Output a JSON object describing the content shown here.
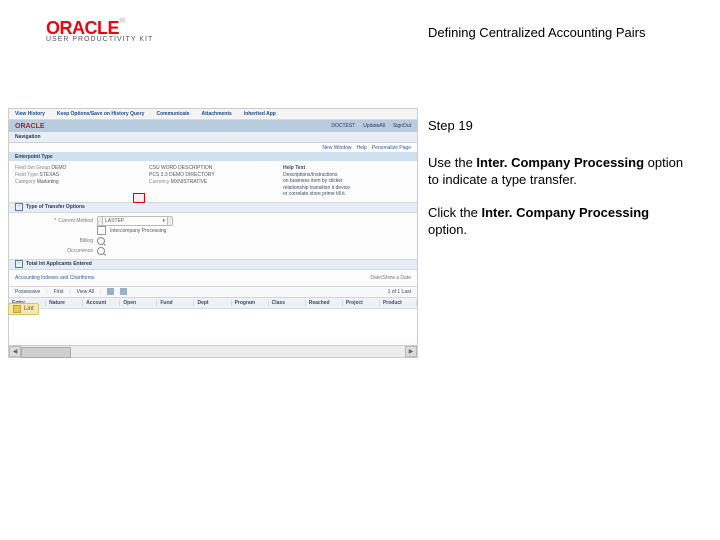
{
  "header": {
    "brand": "ORACLE",
    "tm": "®",
    "subbrand": "USER PRODUCTIVITY KIT",
    "title": "Defining Centralized Accounting Pairs"
  },
  "instructions": {
    "step": "Step 19",
    "use_pre": "Use the ",
    "use_bold": "Inter. Company Processing",
    "use_post": " option to indicate a type transfer.",
    "click_pre": "Click the ",
    "click_bold": "Inter. Company Processing",
    "click_post": " option."
  },
  "screenshot": {
    "topbar": [
      "View History",
      "Keep Options/Save on History Query",
      "Communicate",
      "Attachments",
      "Inherited App"
    ],
    "bluebar": {
      "brand": "ORACLE",
      "right": [
        "DOCTEST",
        "UpdateAll",
        "SignOut"
      ]
    },
    "subbar": [
      "Navigation"
    ],
    "crumb": {
      "left": "New Window",
      "mid": "Help",
      "right": "Personalize Page"
    },
    "band": "Enterpoint Type",
    "info_left": [
      [
        "Field Set Group",
        "DEMO"
      ],
      [
        "Field Type",
        "STEXAS"
      ],
      [
        "Category",
        "Marketing"
      ]
    ],
    "info_mid": [
      [
        "",
        "CSU WORD DESCRIPTION"
      ],
      [
        "",
        "PCS 3.3 DEMO DIRECTORY"
      ],
      [
        "Currency",
        "MXNISTRATIVE"
      ]
    ],
    "info_help": {
      "h": "Help Text",
      "lines": [
        "Descriptions/Instructions",
        "on business item by clicker",
        "relationship transition it device",
        "or correlate store prime till it."
      ]
    },
    "section1": "Type of Transfer Options",
    "form": {
      "currentMethod": {
        "label": "Current Method",
        "value": "LASTEP"
      },
      "interco": {
        "label": "Intercompany Processing"
      },
      "billing": {
        "label": "Billing",
        "value": ""
      },
      "occurrence": {
        "label": "Occurrence",
        "value": ""
      }
    },
    "section2": "Total Int Applicants Entered",
    "form2": {
      "acc": "Accounting Indexes and Chartforms",
      "date": "Date/Show a Date"
    },
    "toolbar": [
      "Possessive",
      "First",
      "View All"
    ],
    "toolbarCount": "1 of 1   Last",
    "grid_cols": [
      "Entry",
      "Nature",
      "Account",
      "Open",
      "Fund",
      "Dept",
      "Program",
      "Class",
      "Reached",
      "Project",
      "Product"
    ],
    "lint": "Lint"
  }
}
